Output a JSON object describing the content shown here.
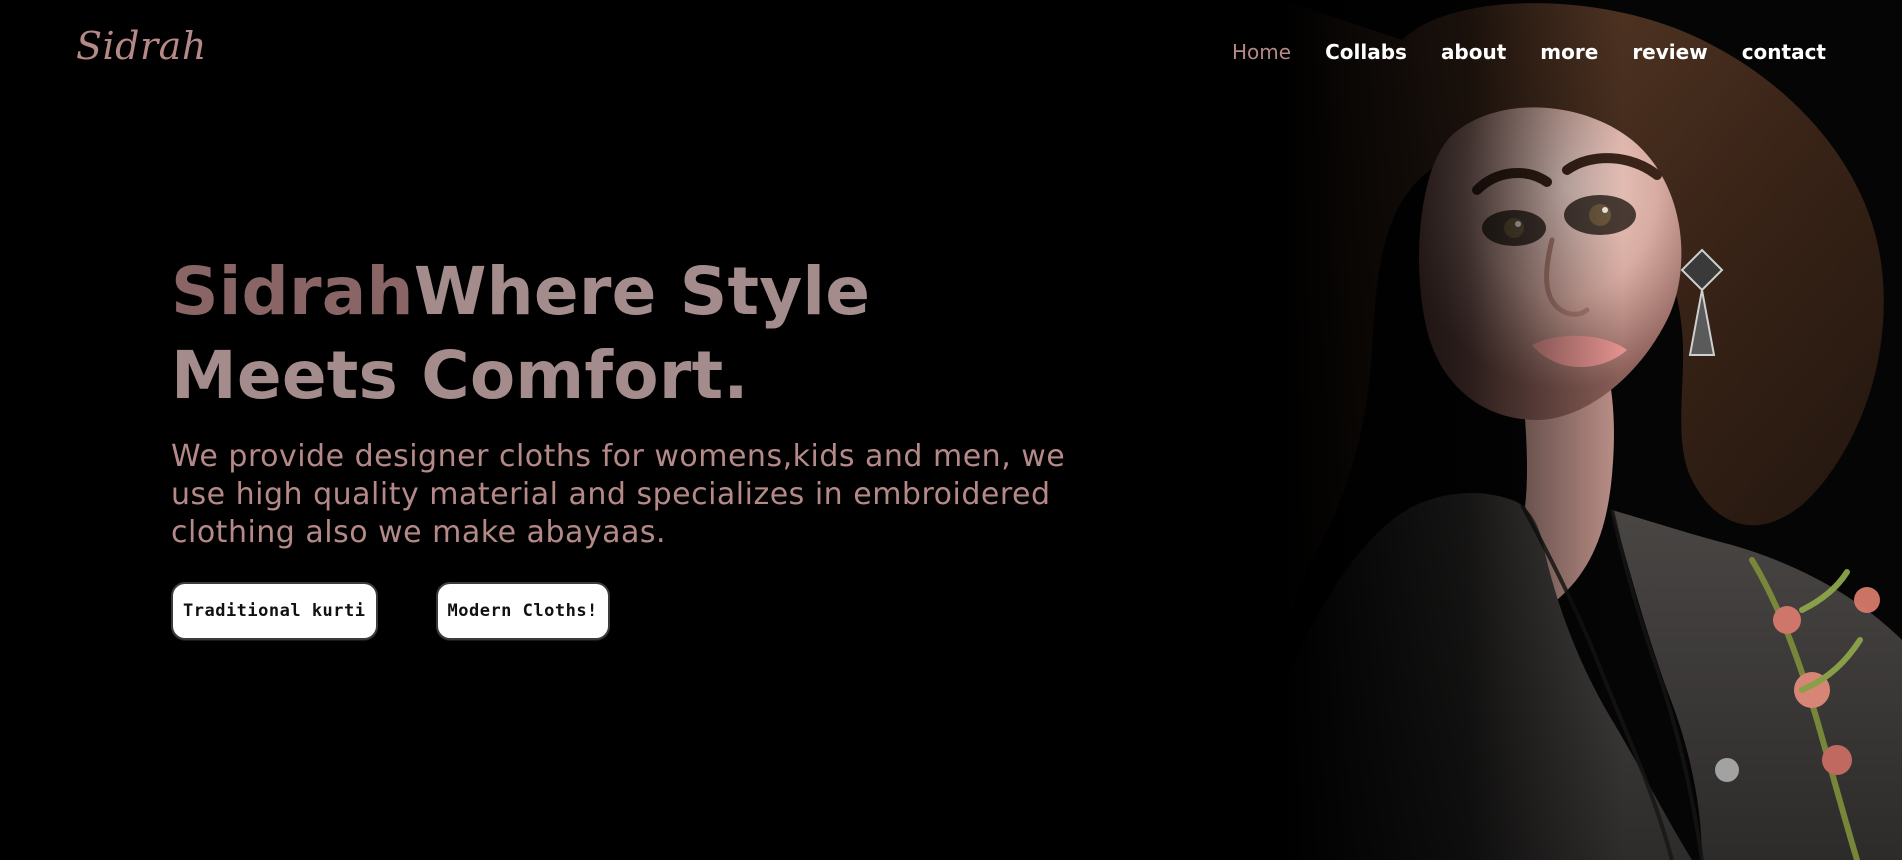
{
  "brand": {
    "name": "Sidrah"
  },
  "nav": {
    "items": [
      {
        "label": "Home",
        "active": true
      },
      {
        "label": "Collabs",
        "active": false
      },
      {
        "label": "about",
        "active": false
      },
      {
        "label": "more",
        "active": false
      },
      {
        "label": "review",
        "active": false
      },
      {
        "label": "contact",
        "active": false
      }
    ]
  },
  "hero": {
    "headline_brand": "Sidrah",
    "headline_rest": "Where Style Meets Comfort.",
    "subtext": "We provide designer cloths for womens,kids and men, we use high quality material and specializes in embroidered clothing also we make abayaas.",
    "buttons": [
      {
        "label": "Traditional kurti"
      },
      {
        "label": "Modern Cloths!"
      }
    ]
  },
  "colors": {
    "background": "#000000",
    "accent_rose": "#B48987",
    "headline": "#A48C8D",
    "headline_brand": "#8A6566",
    "nav_text": "#FFFFFF",
    "button_bg": "#FFFFFF",
    "button_text": "#111111"
  },
  "icons": {
    "hero_image": "woman-portrait-illustration"
  }
}
